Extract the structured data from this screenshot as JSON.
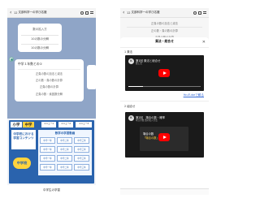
{
  "left": {
    "header": {
      "back": "‹",
      "count": "12",
      "title": "文部科学一の学び応援"
    },
    "bubble1": {
      "items": [
        "数の拡入方",
        "10の数の分解",
        "10の数の分解"
      ]
    },
    "bubble2": {
      "title": "中学１年数との①",
      "items": [
        "正負の数の加法と減法",
        "正の数・負の数の計算",
        "正負の数の計算",
        "正負の数・素因数分解"
      ]
    },
    "menu": {
      "tabs": [
        "小学",
        "中学",
        "メニュー1",
        "メニュー2",
        "メニュー3"
      ],
      "box_left": [
        "中学校における",
        "学習コンテンツ"
      ],
      "mid_caption": "数学の学習動画",
      "grid": [
        "中学一年",
        "中学二年",
        "中学三年",
        "中学一年",
        "中学二年",
        "中学三年",
        "中学一年",
        "中学二年",
        "中学三年",
        "中学一年",
        "中学二年",
        "中学三年"
      ],
      "badge": "中学校",
      "footer": "中学生の学習"
    }
  },
  "right": {
    "header": {
      "back": "‹",
      "count": "12",
      "title": "文部科学一の学び応援"
    },
    "dim_lines": [
      "正負の数の加法と減法",
      "正の数・負の数の計算",
      "正負の数の計算"
    ],
    "sheet": {
      "title": "乗法・総合せ",
      "subtitle": "",
      "close": "✕",
      "section1": "1 乗法",
      "section2": "2 組合せ",
      "video1": {
        "avatar": "K",
        "title": "第1回 乗法と総合せ",
        "sub": "数と式",
        "progress": 0.2
      },
      "video2": {
        "avatar": "K",
        "title": "第2回　場合の数・確率",
        "sub": "場合の数 数の拡入方法",
        "slide_line1": "場合の数",
        "slide_line2": "「場合の数」とは"
      },
      "yt_link": "YouTubeで観る"
    }
  },
  "colors": {
    "chat_bg": "#8fa5c7",
    "menu_blue": "#2a63ad",
    "yt_red": "#ff0000",
    "badge_yellow": "#ffd33d"
  }
}
